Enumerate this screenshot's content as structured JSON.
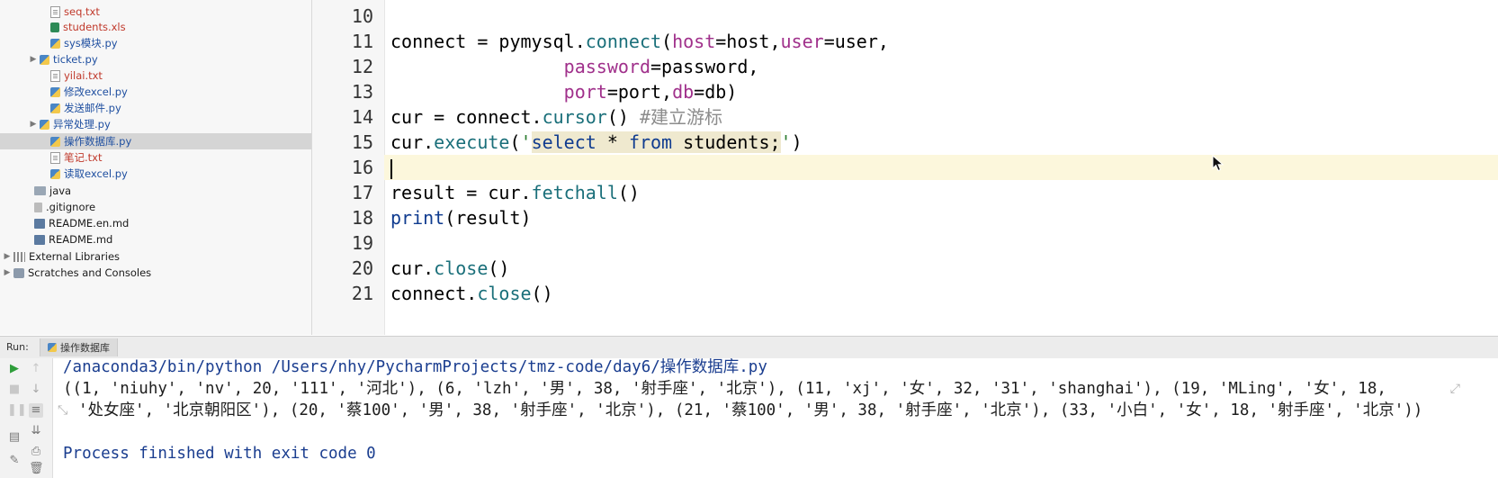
{
  "tree": {
    "items": [
      {
        "label": "seq.txt",
        "icon": "text-file-icon",
        "color": "red"
      },
      {
        "label": "students.xls",
        "icon": "excel-file-icon",
        "color": "red"
      },
      {
        "label": "sys模块.py",
        "icon": "python-file-icon",
        "color": "blue"
      },
      {
        "label": "ticket.py",
        "icon": "python-file-icon",
        "color": "blue"
      },
      {
        "label": "yilai.txt",
        "icon": "text-file-icon",
        "color": "red"
      },
      {
        "label": "修改excel.py",
        "icon": "python-file-icon",
        "color": "blue"
      },
      {
        "label": "发送邮件.py",
        "icon": "python-file-icon",
        "color": "blue"
      },
      {
        "label": "异常处理.py",
        "icon": "python-file-icon",
        "color": "blue"
      },
      {
        "label": "操作数据库.py",
        "icon": "python-file-icon",
        "color": "blue"
      },
      {
        "label": "笔记.txt",
        "icon": "text-file-icon",
        "color": "red"
      },
      {
        "label": "读取excel.py",
        "icon": "python-file-icon",
        "color": "blue"
      },
      {
        "label": "java",
        "icon": "folder-icon",
        "color": "black"
      },
      {
        "label": ".gitignore",
        "icon": "gitignore-file-icon",
        "color": "black"
      },
      {
        "label": "README.en.md",
        "icon": "markdown-file-icon",
        "color": "black"
      },
      {
        "label": "README.md",
        "icon": "markdown-file-icon",
        "color": "black"
      },
      {
        "label": "External Libraries",
        "icon": "library-icon",
        "color": "black"
      },
      {
        "label": "Scratches and Consoles",
        "icon": "scratches-icon",
        "color": "black"
      }
    ]
  },
  "editor": {
    "line_numbers": [
      "10",
      "11",
      "12",
      "13",
      "14",
      "15",
      "16",
      "17",
      "18",
      "19",
      "20",
      "21"
    ],
    "current_line": "16"
  },
  "run": {
    "label": "Run:",
    "tab": "操作数据库",
    "output": {
      "command": "/anaconda3/bin/python /Users/nhy/PycharmProjects/tmz-code/day6/操作数据库.py",
      "result_line1": "((1, 'niuhy', 'nv', 20, '111', '河北'), (6, 'lzh', '男', 38, '射手座', '北京'), (11, 'xj', '女', 32, '31', 'shanghai'), (19, 'MLing', '女', 18,",
      "result_line2": "'处女座', '北京朝阳区'), (20, '蔡100', '男', 38, '射手座', '北京'), (21, '蔡100', '男', 38, '射手座', '北京'), (33, '小白', '女', 18, '射手座', '北京'))",
      "exit": "Process finished with exit code 0"
    }
  },
  "colors": {
    "selected_row": "#d5d5d5",
    "current_line_bg": "#fcf7dc",
    "keyword": "#0f3b8f",
    "string": "#2e7d32",
    "param": "#a0308b",
    "comment": "#8c8c8c"
  }
}
